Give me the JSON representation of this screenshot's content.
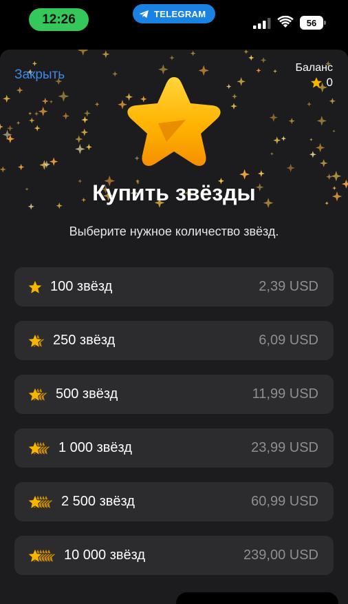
{
  "status_bar": {
    "time": "12:26",
    "app_pill": "TELEGRAM",
    "battery": "56"
  },
  "header": {
    "close_label": "Закрыть",
    "balance_label": "Баланс",
    "balance_value": "0"
  },
  "title": "Купить звёзды",
  "subtitle": "Выберите нужное количество звёзд.",
  "colors": {
    "accent_link": "#3c8ae6",
    "star_gold": "#f7b500",
    "sheet_bg": "#1c1c1e",
    "card_bg": "#2c2c2e",
    "price_gray": "#8e8e93",
    "time_pill": "#34c759",
    "telegram_pill": "#1a82e2"
  },
  "options": [
    {
      "label": "100 звёзд",
      "price": "2,39 USD",
      "icon": "star-stack-1-icon",
      "stars": 1
    },
    {
      "label": "250 звёзд",
      "price": "6,09 USD",
      "icon": "star-stack-2-icon",
      "stars": 2
    },
    {
      "label": "500 звёзд",
      "price": "11,99 USD",
      "icon": "star-stack-3-icon",
      "stars": 3
    },
    {
      "label": "1 000 звёзд",
      "price": "23,99 USD",
      "icon": "star-stack-4-icon",
      "stars": 4
    },
    {
      "label": "2 500 звёзд",
      "price": "60,99 USD",
      "icon": "star-stack-5-icon",
      "stars": 5
    },
    {
      "label": "10 000 звёзд",
      "price": "239,00 USD",
      "icon": "star-stack-6-icon",
      "stars": 6
    }
  ]
}
